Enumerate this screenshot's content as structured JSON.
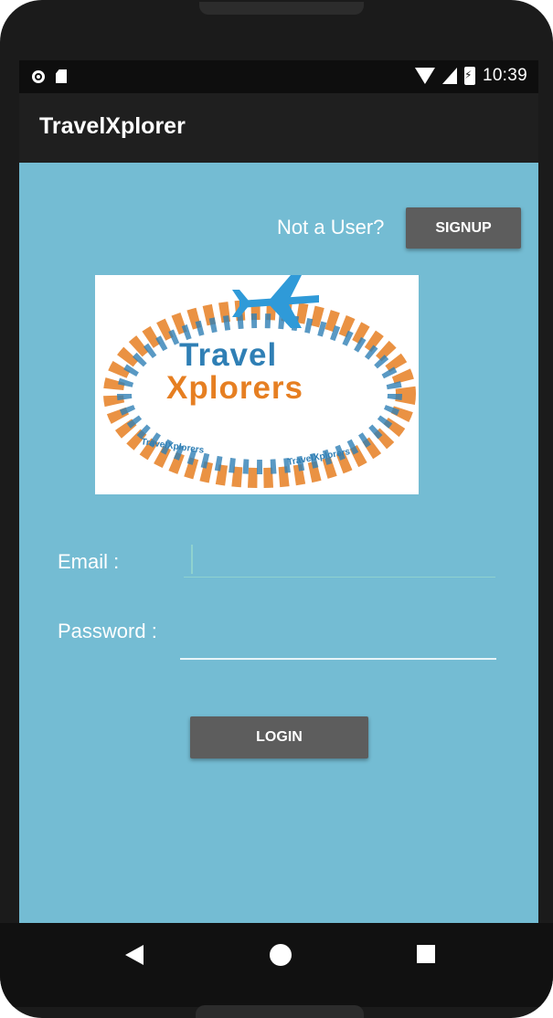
{
  "status_bar": {
    "time": "10:39",
    "icons": [
      "notification-dot-icon",
      "sd-card-icon",
      "wifi-icon",
      "cell-signal-icon",
      "battery-charging-icon"
    ]
  },
  "app_bar": {
    "title": "TravelXplorer"
  },
  "signup_section": {
    "prompt": "Not a User?",
    "button_label": "SIGNUP"
  },
  "logo": {
    "line1": "Travel",
    "line2": "Xplorers",
    "small_text_left": "TravelXplorers",
    "small_text_right": "TravelXplorers",
    "colors": {
      "blue": "#2f7fb5",
      "orange": "#e67f22"
    }
  },
  "form": {
    "email_label": "Email :",
    "email_value": "",
    "password_label": "Password :",
    "password_value": "",
    "login_label": "LOGIN"
  },
  "navigation": {
    "icons": [
      "back-icon",
      "home-icon",
      "recent-apps-icon"
    ]
  },
  "colors": {
    "screen_background": "#74bcd3",
    "app_bar": "#1f1f1f",
    "button": "#5d5d5d"
  }
}
